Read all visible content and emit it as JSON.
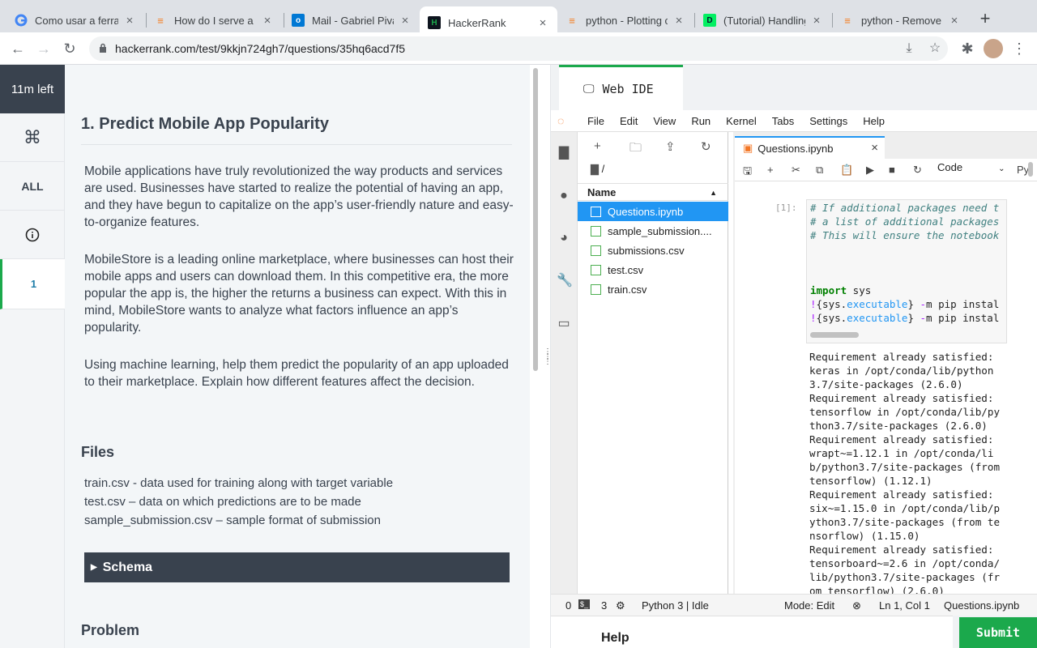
{
  "browser": {
    "tabs": [
      {
        "title": "Como usar a ferram",
        "fav_color": "#ffffff"
      },
      {
        "title": "How do I serve a t",
        "fav_color": "#f48024"
      },
      {
        "title": "Mail - Gabriel Piva",
        "fav_color": "#0078d4"
      },
      {
        "title": "HackerRank",
        "fav_color": "#0e141e"
      },
      {
        "title": "python - Plotting c",
        "fav_color": "#f48024"
      },
      {
        "title": "(Tutorial) Handling",
        "fav_color": "#03ef62"
      },
      {
        "title": "python - Remove c",
        "fav_color": "#f48024"
      }
    ],
    "url": "hackerrank.com/test/9kkjn724gh7/questions/35hq6acd7f5"
  },
  "rail": {
    "timer": "11m left",
    "all_label": "ALL",
    "question_number": "1"
  },
  "question": {
    "title": "1. Predict Mobile App Popularity",
    "paragraphs": [
      "Mobile applications have truly revolutionized the way products and services are used. Businesses have started to realize the potential of having an app, and they have begun to capitalize on the app’s user-friendly nature and easy-to-organize features.",
      "MobileStore is a leading online marketplace, where businesses can host their mobile apps and users can download them. In this competitive era, the more popular the app is, the higher the returns a business can expect. With this in mind, MobileStore wants to analyze what factors influence an app’s popularity.",
      "Using machine learning, help them predict the popularity of an app uploaded to their marketplace. Explain how different features affect the decision."
    ],
    "files_heading": "Files",
    "files": [
      "train.csv - data used for training along with target variable",
      "test.csv – data on which predictions are to be made",
      "sample_submission.csv – sample format of submission"
    ],
    "schema_label": "Schema",
    "problem_heading": "Problem"
  },
  "ide": {
    "tab_label": "Web IDE",
    "menu": [
      "File",
      "Edit",
      "View",
      "Run",
      "Kernel",
      "Tabs",
      "Settings",
      "Help"
    ],
    "filebrowser": {
      "path": "/",
      "column_name": "Name",
      "files": [
        "Questions.ipynb",
        "sample_submission....",
        "submissions.csv",
        "test.csv",
        "train.csv"
      ]
    },
    "notebook": {
      "tab_title": "Questions.ipynb",
      "cell_type": "Code",
      "kernel_short": "Pyt",
      "prompt": "[1]:",
      "code_lines": [
        "# If additional packages need t",
        "# a list of additional packages",
        "# This will ensure the notebook",
        "",
        "",
        "",
        "import sys",
        "!{sys.executable} -m pip instal",
        "!{sys.executable} -m pip instal"
      ],
      "output": "Requirement already satisfied:\nkeras in /opt/conda/lib/python\n3.7/site-packages (2.6.0)\nRequirement already satisfied:\ntensorflow in /opt/conda/lib/py\nthon3.7/site-packages (2.6.0)\nRequirement already satisfied:\nwrapt~=1.12.1 in /opt/conda/li\nb/python3.7/site-packages (from\ntensorflow) (1.12.1)\nRequirement already satisfied:\nsix~=1.15.0 in /opt/conda/lib/p\nython3.7/site-packages (from te\nnsorflow) (1.15.0)\nRequirement already satisfied:\ntensorboard~=2.6 in /opt/conda/\nlib/python3.7/site-packages (fr\nom tensorflow) (2.6.0)"
    },
    "status": {
      "zero": "0",
      "terminals": "3",
      "kernel": "Python 3 | Idle",
      "mode": "Mode: Edit",
      "position": "Ln 1, Col 1",
      "file": "Questions.ipynb"
    },
    "help_label": "Help",
    "submit_label": "Submit"
  }
}
